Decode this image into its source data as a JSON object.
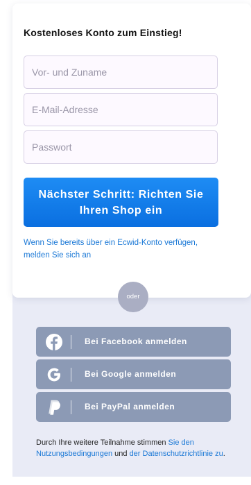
{
  "signup": {
    "title": "Kostenloses Konto zum Einstieg!",
    "name_placeholder": "Vor- und Zuname",
    "email_placeholder": "E-Mail-Adresse",
    "password_placeholder": "Passwort",
    "next_button_label": "Nächster Schritt: Richten Sie Ihren Shop ein",
    "login_link": "Wenn Sie bereits über ein Ecwid-Konto verfügen, melden Sie sich an"
  },
  "divider": {
    "label": "oder"
  },
  "social": {
    "facebook": {
      "label": "Bei Facebook anmelden",
      "icon": "facebook-icon"
    },
    "google": {
      "label": "Bei Google anmelden",
      "icon": "google-icon"
    },
    "paypal": {
      "label": "Bei PayPal anmelden",
      "icon": "paypal-icon"
    }
  },
  "terms": {
    "prefix": "Durch Ihre weitere Teilnahme stimmen ",
    "terms_link": "Sie den Nutzungsbedingungen",
    "middle": " und ",
    "privacy_link": "der Datenschutzrichtlinie zu",
    "suffix": "."
  },
  "colors": {
    "primary_button": "#0a6fe0",
    "link": "#1a78d6",
    "social_button": "#8c9ab5",
    "lower_panel": "#e9ebf6"
  }
}
